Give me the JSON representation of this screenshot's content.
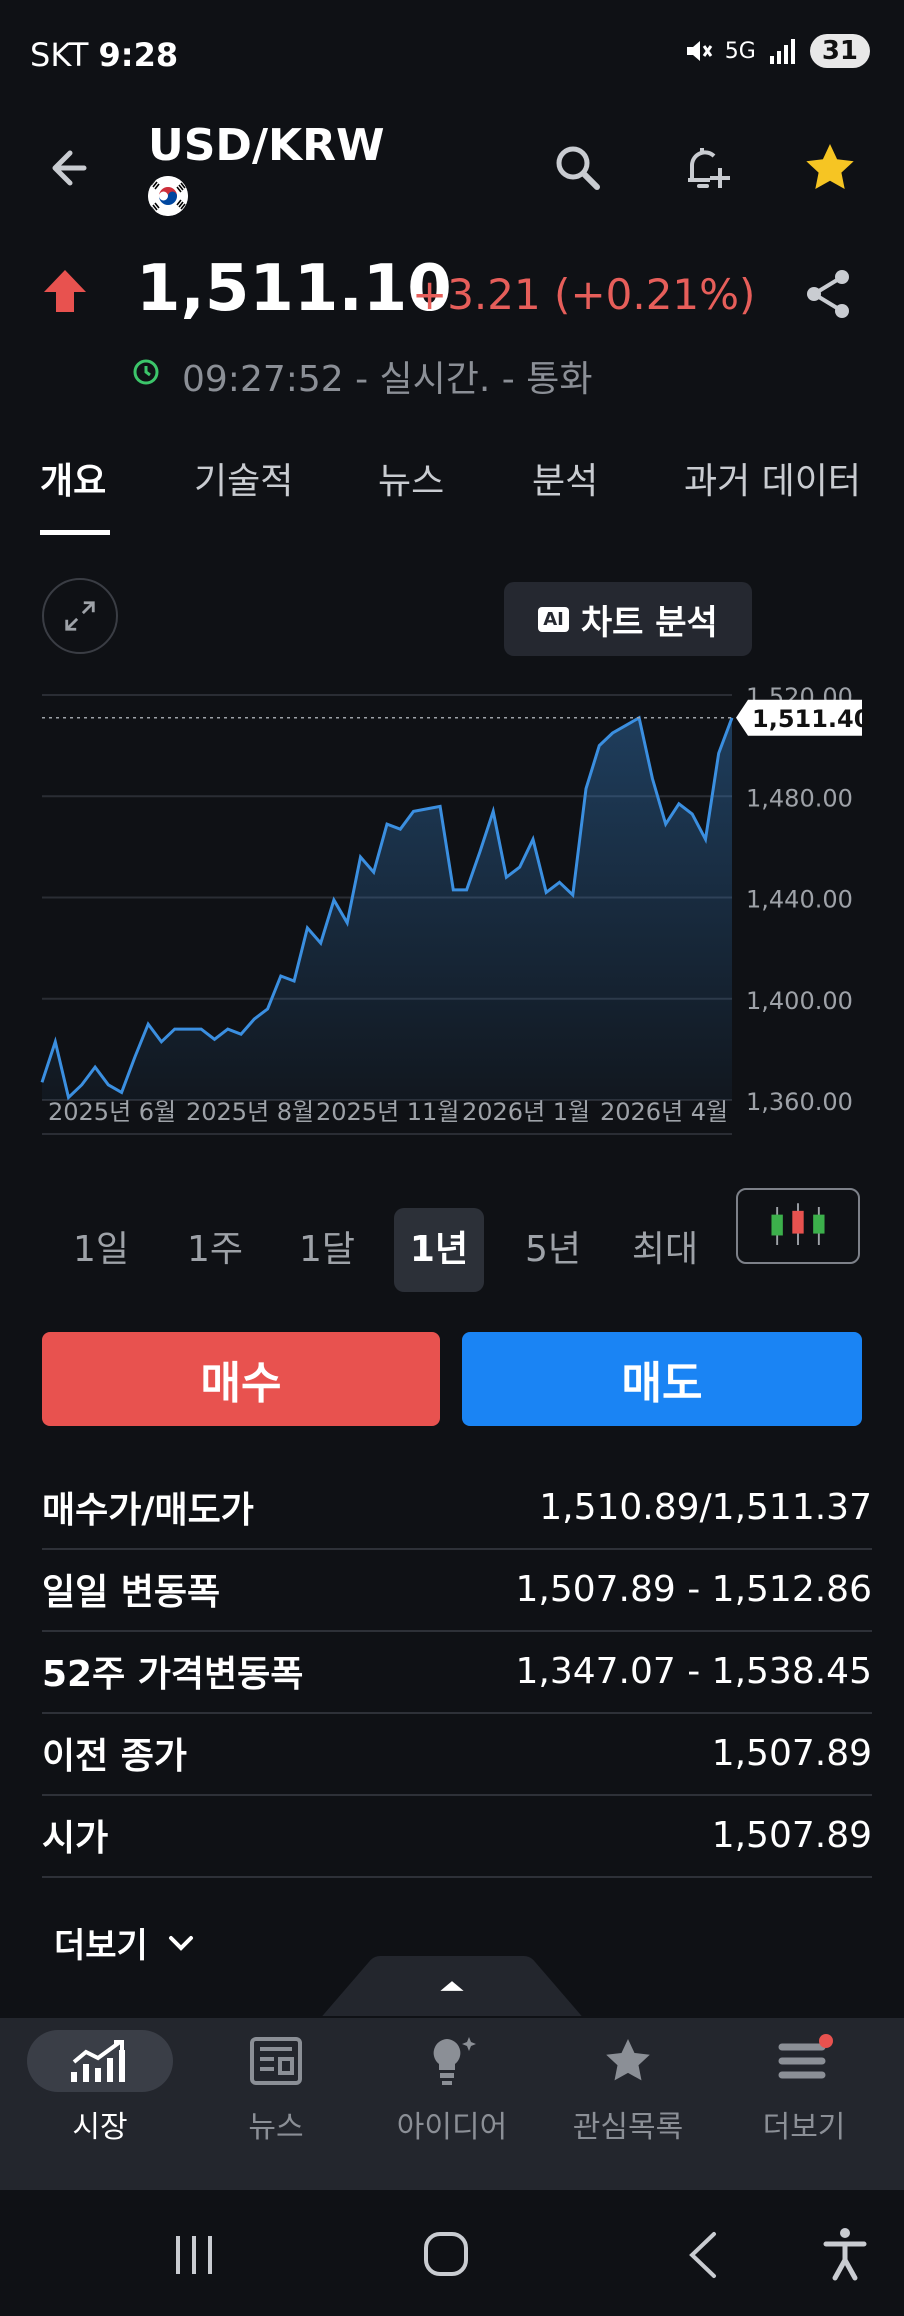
{
  "status": {
    "carrier": "SKT",
    "time": "9:28",
    "network": "5G",
    "battery": "31"
  },
  "header": {
    "symbol": "USD/KRW"
  },
  "quote": {
    "price": "1,511.10",
    "change": "+3.21 (+0.21%)",
    "time_text": "09:27:52 - 실시간. - 통화",
    "up_color": "#e65e5a"
  },
  "tabs": [
    "개요",
    "기술적",
    "뉴스",
    "분석",
    "과거 데이터"
  ],
  "chart_button": "차트 분석",
  "chart_button_badge": "AI",
  "chart_data": {
    "type": "area",
    "x_tick_labels": [
      "2025년 6월",
      "2025년 8월",
      "2025년 11월",
      "2026년 1월",
      "2026년 4월"
    ],
    "y_tick_labels": [
      "1,360.00",
      "1,400.00",
      "1,440.00",
      "1,480.00",
      "1,520.00"
    ],
    "ylim": [
      1360,
      1520
    ],
    "last_value_label": "1,511.40",
    "line_color": "#3b8fe0",
    "values": [
      1367,
      1383,
      1361,
      1366,
      1373,
      1366,
      1363,
      1377,
      1390,
      1383,
      1388,
      1388,
      1388,
      1384,
      1388,
      1386,
      1392,
      1396,
      1409,
      1407,
      1428,
      1422,
      1439,
      1430,
      1456,
      1450,
      1469,
      1467,
      1474,
      1475,
      1476,
      1443,
      1443,
      1458,
      1474,
      1448,
      1452,
      1463,
      1442,
      1446,
      1441,
      1483,
      1500,
      1505,
      1508,
      1511,
      1487,
      1469,
      1477,
      1473,
      1463,
      1497,
      1511
    ]
  },
  "periods": [
    "1일",
    "1주",
    "1달",
    "1년",
    "5년",
    "최대"
  ],
  "active_period": "1년",
  "actions": {
    "buy": "매수",
    "sell": "매도",
    "buy_color": "#e8524f",
    "sell_color": "#1a84f4"
  },
  "stats": [
    {
      "label": "매수가/매도가",
      "value": "1,510.89/1,511.37"
    },
    {
      "label": "일일 변동폭",
      "value": "1,507.89 - 1,512.86"
    },
    {
      "label": "52주 가격변동폭",
      "value": "1,347.07 - 1,538.45"
    },
    {
      "label": "이전 종가",
      "value": "1,507.89"
    },
    {
      "label": "시가",
      "value": "1,507.89"
    }
  ],
  "more_label": "더보기",
  "nav": [
    {
      "label": "시장",
      "icon": "market-chart-icon"
    },
    {
      "label": "뉴스",
      "icon": "news-icon"
    },
    {
      "label": "아이디어",
      "icon": "idea-bulb-icon"
    },
    {
      "label": "관심목록",
      "icon": "star-icon"
    },
    {
      "label": "더보기",
      "icon": "menu-icon"
    }
  ]
}
